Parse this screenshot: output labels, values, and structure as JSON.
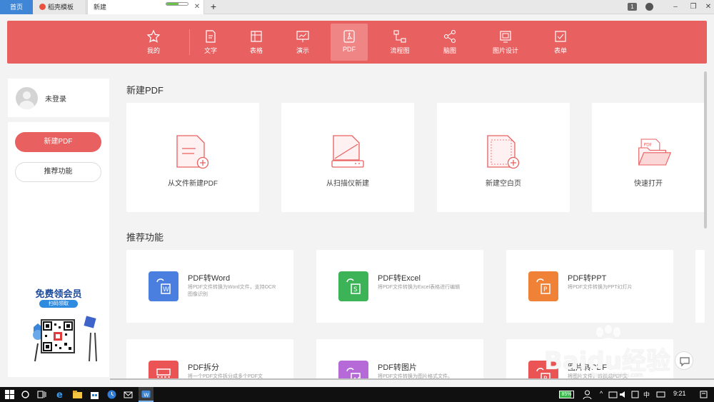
{
  "tabs": [
    {
      "label": "首页"
    },
    {
      "label": "稻壳模板"
    },
    {
      "label": "新建"
    }
  ],
  "window": {
    "notification_count": "1",
    "tab_loading_fraction": 0.55
  },
  "categories": [
    {
      "label": "我的",
      "icon": "star-icon"
    },
    {
      "label": "文字",
      "icon": "document-icon"
    },
    {
      "label": "表格",
      "icon": "spreadsheet-icon"
    },
    {
      "label": "演示",
      "icon": "presentation-icon"
    },
    {
      "label": "PDF",
      "icon": "pdf-icon",
      "active": true
    },
    {
      "label": "流程图",
      "icon": "flowchart-icon"
    },
    {
      "label": "脑图",
      "icon": "mindmap-icon"
    },
    {
      "label": "图片设计",
      "icon": "image-design-icon"
    },
    {
      "label": "表单",
      "icon": "form-icon"
    }
  ],
  "sidebar": {
    "user_name": "未登录",
    "primary_button": "新建PDF",
    "secondary_button": "推荐功能",
    "promo_title": "免费领会员",
    "promo_button": "扫码领取"
  },
  "main": {
    "new_title": "新建PDF",
    "new_cards": [
      {
        "label": "从文件新建PDF"
      },
      {
        "label": "从扫描仪新建"
      },
      {
        "label": "新建空白页"
      },
      {
        "label": "快速打开"
      }
    ],
    "features_title": "推荐功能",
    "features": [
      {
        "title": "PDF转Word",
        "desc": "将PDF文件转换为Word文件，支持OCR图像识别",
        "color": "#4a7fe0"
      },
      {
        "title": "PDF转Excel",
        "desc": "将PDF文件转换为Excel表格进行编辑",
        "color": "#3db357"
      },
      {
        "title": "PDF转PPT",
        "desc": "将PDF文件转换为PPT幻灯片",
        "color": "#f08237"
      },
      {
        "title": "PDF拆分",
        "desc": "将一个PDF文件拆分成多个PDF文",
        "color": "#ea5454"
      },
      {
        "title": "PDF转图片",
        "desc": "将PDF文件转换为图片格式文件。",
        "color": "#b66ad8"
      },
      {
        "title": "图片转PDF",
        "desc": "将图片文件，转换成PDF文",
        "color": "#ea5454"
      }
    ]
  },
  "watermark": {
    "logo": "Baidu经验",
    "url": "jingyan.baidu.com"
  },
  "taskbar": {
    "battery": "85%",
    "ime": "中",
    "clock": "9:21"
  },
  "colors": {
    "accent": "#e96060",
    "tab_active": "#3f86d6"
  }
}
